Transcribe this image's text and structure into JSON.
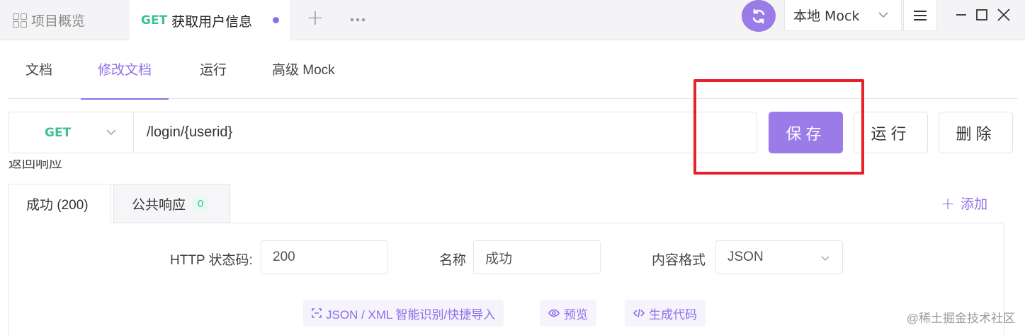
{
  "topbar": {
    "overview_label": "项目概览",
    "active_tab": {
      "method": "GET",
      "title": "获取用户信息"
    },
    "new_tab_glyph": "+",
    "more_glyph": "•••",
    "mock_env": "本地 Mock",
    "icons": [
      "grid-icon",
      "sync-icon",
      "chevron-down-icon",
      "menu-icon",
      "minimize-icon",
      "maximize-icon",
      "close-icon"
    ]
  },
  "subtabs": [
    {
      "label": "文档"
    },
    {
      "label": "修改文档"
    },
    {
      "label": "运行"
    },
    {
      "label": "高级 Mock"
    }
  ],
  "request": {
    "method": "GET",
    "path": "/login/{userid}",
    "save_label": "保存",
    "run_label": "运行",
    "delete_label": "删除"
  },
  "response": {
    "section_title": "返回响应",
    "tabs": [
      {
        "label": "成功 (200)"
      },
      {
        "label": "公共响应",
        "count": "0"
      }
    ],
    "add_label": "添加",
    "status_code_label": "HTTP 状态码:",
    "status_code_value": "200",
    "name_label": "名称",
    "name_value": "成功",
    "format_label": "内容格式",
    "format_value": "JSON",
    "tools": {
      "import_label": "JSON / XML 智能识别/快捷导入",
      "preview_label": "预览",
      "codegen_label": "生成代码"
    }
  },
  "colors": {
    "accent": "#9b7be8",
    "method_get": "#3cc08e",
    "highlight": "#e8202a"
  },
  "watermark": "@稀土掘金技术社区"
}
